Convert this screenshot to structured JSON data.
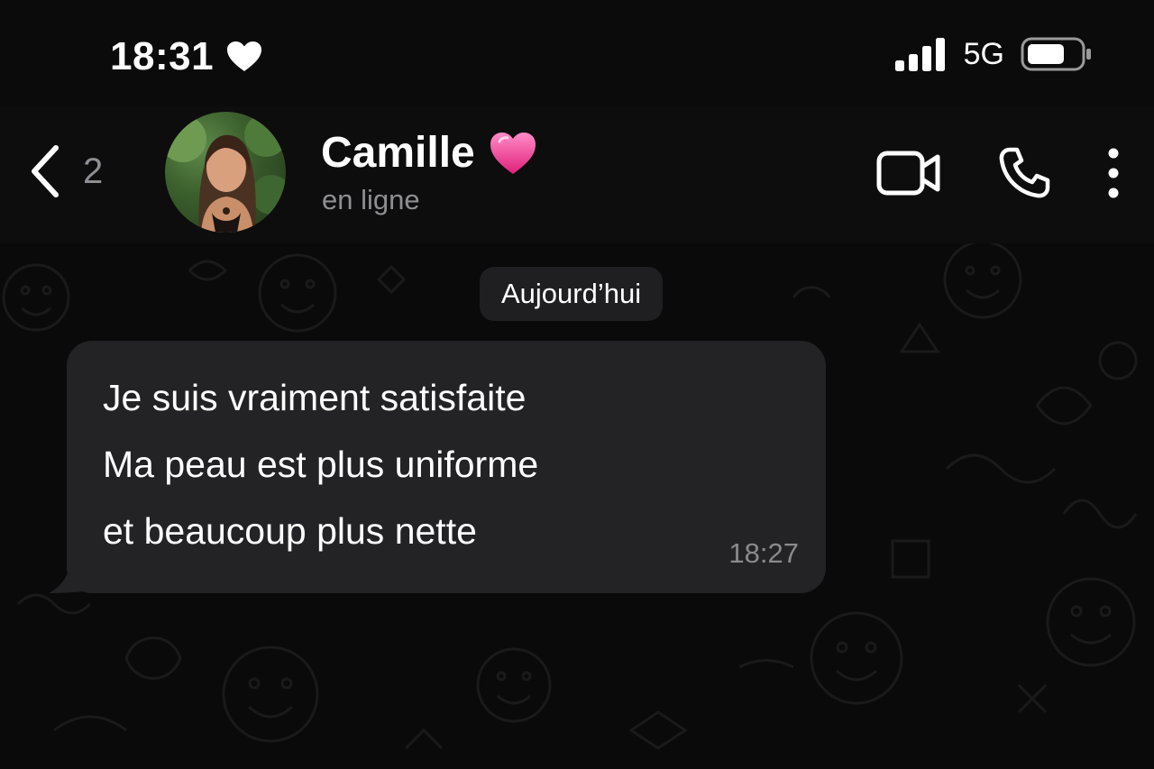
{
  "status_bar": {
    "time": "18:31",
    "heart_icon": "heart-icon",
    "network": "5G",
    "signal_icon": "signal-bars-icon",
    "battery_icon": "battery-icon"
  },
  "header": {
    "back_count": "2",
    "contact_name": "Camille",
    "name_emoji": "💗",
    "status": "en ligne",
    "actions": [
      "video-call-icon",
      "phone-icon",
      "more-vertical-icon"
    ]
  },
  "chat": {
    "date_label": "Aujourd’hui",
    "messages": [
      {
        "lines": [
          "Je suis vraiment satisfaite",
          "Ma peau est plus uniforme",
          "et beaucoup plus nette"
        ],
        "time": "18:27"
      }
    ]
  },
  "colors": {
    "background": "#0b0b0b",
    "bubble": "#232325",
    "secondary_text": "#8e8e93",
    "accent_heart": "#ff4fa3"
  }
}
